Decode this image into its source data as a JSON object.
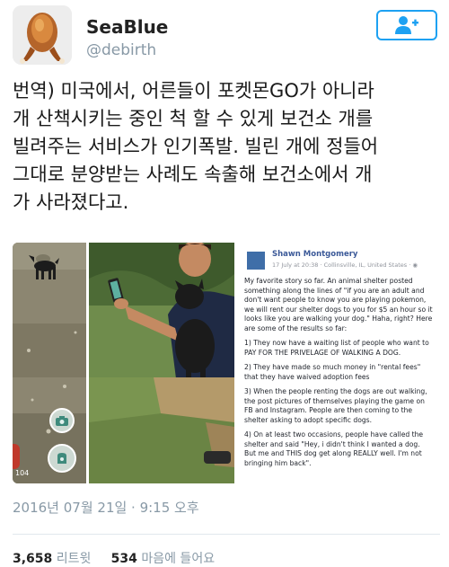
{
  "user": {
    "display_name": "SeaBlue",
    "handle": "@debirth"
  },
  "follow_button": {
    "icon": "add-user-icon"
  },
  "tweet": {
    "text": "번역) 미국에서, 어른들이 포켓몬GO가 아니라\n개 산책시키는 중인 척 할 수 있게 보건소 개를\n빌려주는 서비스가 인기폭발. 빌린 개에 정들어\n그대로 분양받는 사례도 속출해 보건소에서 개\n가 사라졌다고.",
    "timestamp": "2016년 07월 21일 · 9:15 오후"
  },
  "media": {
    "left_panel_counter": "104",
    "post": {
      "author": "Shawn Montgomery",
      "meta": "17 July at 20:38 · Collinsville, IL, United States · ",
      "paragraphs": [
        "My favorite story so far. An animal shelter posted something along the lines of \"if you are an adult and don't want people to know you are playing pokemon, we will rent our shelter dogs to you for $5 an hour so it looks like you are walking your dog.\" Haha, right? Here are some of the results so far:",
        "1) They now have a waiting list of people who want to PAY FOR THE PRIVELAGE OF WALKING A DOG.",
        "2) They have made so much money in \"rental fees\" that they have waived adoption fees",
        "3) When the people renting the dogs are out walking, the post pictures of themselves playing the game on FB and Instagram. People are then coming to the shelter asking to adopt specific dogs.",
        "4) On at least two occasions, people have called the shelter and said \"Hey, i didn't think I wanted a dog. But me and THIS dog get along REALLY well. I'm not bringing him back\"."
      ]
    }
  },
  "stats": {
    "retweets_count": "3,658",
    "retweets_label": "리트윗",
    "likes_count": "534",
    "likes_label": "마음에 들어요"
  },
  "colors": {
    "accent": "#1da1f2",
    "secondary_text": "#8899a6"
  }
}
